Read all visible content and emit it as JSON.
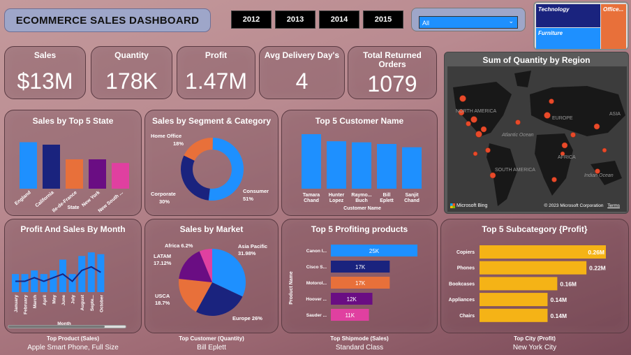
{
  "header": {
    "title": "ECOMMERCE SALES DASHBOARD"
  },
  "years": [
    "2012",
    "2013",
    "2014",
    "2015"
  ],
  "filter": {
    "selected": "All"
  },
  "category_tiles": {
    "technology": "Technology",
    "office": "Office...",
    "furniture": "Furniture"
  },
  "kpis": {
    "sales": {
      "label": "Sales",
      "value": "$13M"
    },
    "quantity": {
      "label": "Quantity",
      "value": "178K"
    },
    "profit": {
      "label": "Profit",
      "value": "1.47M"
    },
    "delivery": {
      "label": "Avg Delivery Day's",
      "value": "4"
    },
    "returned": {
      "label": "Total Returned Orders",
      "value": "1079"
    }
  },
  "map": {
    "title": "Sum of Quantity by Region",
    "brand": "Microsoft Bing",
    "copyright": "© 2023 Microsoft Corporation",
    "terms": "Terms",
    "labels": {
      "na": "NORTH AMERICA",
      "europe": "EUROPE",
      "asia": "ASIA",
      "africa": "AFRICA",
      "sa": "SOUTH AMERICA",
      "atlantic": "Atlantic Ocean",
      "indian": "Indian Ocean"
    }
  },
  "colors": {
    "blue": "#1e90ff",
    "navy": "#1a237e",
    "orange": "#e8703a",
    "purple": "#6a0d83",
    "pink": "#e040a0",
    "gold": "#f5b316"
  },
  "footer": [
    {
      "label": "Top Product (Sales)",
      "value": "Apple Smart Phone, Full Size"
    },
    {
      "label": "Top Customer (Quantity)",
      "value": "Bill Eplett"
    },
    {
      "label": "Top Shipmode (Sales)",
      "value": "Standard Class"
    },
    {
      "label": "Top City (Profit)",
      "value": "New York City"
    }
  ],
  "chart_data": [
    {
      "id": "state",
      "type": "bar",
      "title": "Sales by Top 5 State",
      "xlabel": "State",
      "categories": [
        "England",
        "California",
        "Ile-de-France",
        "New York",
        "New South ..."
      ],
      "values": [
        1.9,
        1.8,
        1.2,
        1.2,
        1.05
      ],
      "ylim": [
        0,
        2
      ]
    },
    {
      "id": "segment",
      "type": "pie",
      "title": "Sales by Segment & Category",
      "categories": [
        "Consumer",
        "Corporate",
        "Home Office"
      ],
      "values": [
        51,
        30,
        18
      ],
      "labels": [
        "51%",
        "30%",
        "18%"
      ]
    },
    {
      "id": "customer",
      "type": "bar",
      "title": "Top 5 Customer Name",
      "xlabel": "Customer Name",
      "categories": [
        "Tamara Chand",
        "Hunter Lopez",
        "Raymo... Buch",
        "Bill Eplett",
        "Sanjit Chand"
      ],
      "values": [
        100,
        87,
        85,
        82,
        76
      ],
      "ylim": [
        0,
        100
      ]
    },
    {
      "id": "month",
      "type": "bar",
      "title": "Profit And Sales By Month",
      "xlabel": "Month",
      "categories": [
        "January",
        "February",
        "March",
        "April",
        "May",
        "June",
        "July",
        "August",
        "Septe...",
        "October"
      ],
      "series": [
        {
          "values": [
            0.5,
            0.5,
            0.6,
            0.5,
            0.6,
            0.9,
            0.5,
            1.0,
            1.1,
            1.05
          ]
        },
        {
          "values": [
            0.3,
            0.3,
            0.4,
            0.3,
            0.4,
            0.5,
            0.3,
            0.6,
            0.7,
            0.55
          ]
        }
      ],
      "ylim": [
        0,
        1.2
      ]
    },
    {
      "id": "market",
      "type": "pie",
      "title": "Sales by Market",
      "categories": [
        "Asia Pacific",
        "Europe",
        "USCA",
        "LATAM",
        "Africa"
      ],
      "values": [
        31.98,
        26,
        18.7,
        17.12,
        6.2
      ],
      "labels": [
        "31.98%",
        "26%",
        "18.7%",
        "17.12%",
        "6.2%"
      ]
    },
    {
      "id": "products",
      "type": "bar",
      "title": "Top 5 Profiting products",
      "ylabel": "Product Name",
      "categories": [
        "Canon I...",
        "Cisco S...",
        "Motorol...",
        "Hoover ...",
        "Sauder ..."
      ],
      "values": [
        25,
        17,
        17,
        12,
        11
      ],
      "labels": [
        "25K",
        "17K",
        "17K",
        "12K",
        "11K"
      ],
      "xlim": [
        0,
        25
      ]
    },
    {
      "id": "subcat",
      "type": "bar",
      "title": "Top 5 Subcategory {Profit}",
      "categories": [
        "Copiers",
        "Phones",
        "Bookcases",
        "Appliances",
        "Chairs"
      ],
      "values": [
        0.26,
        0.22,
        0.16,
        0.14,
        0.14
      ],
      "labels": [
        "0.26M",
        "0.22M",
        "0.16M",
        "0.14M",
        "0.14M"
      ],
      "xlim": [
        0,
        0.26
      ]
    }
  ]
}
